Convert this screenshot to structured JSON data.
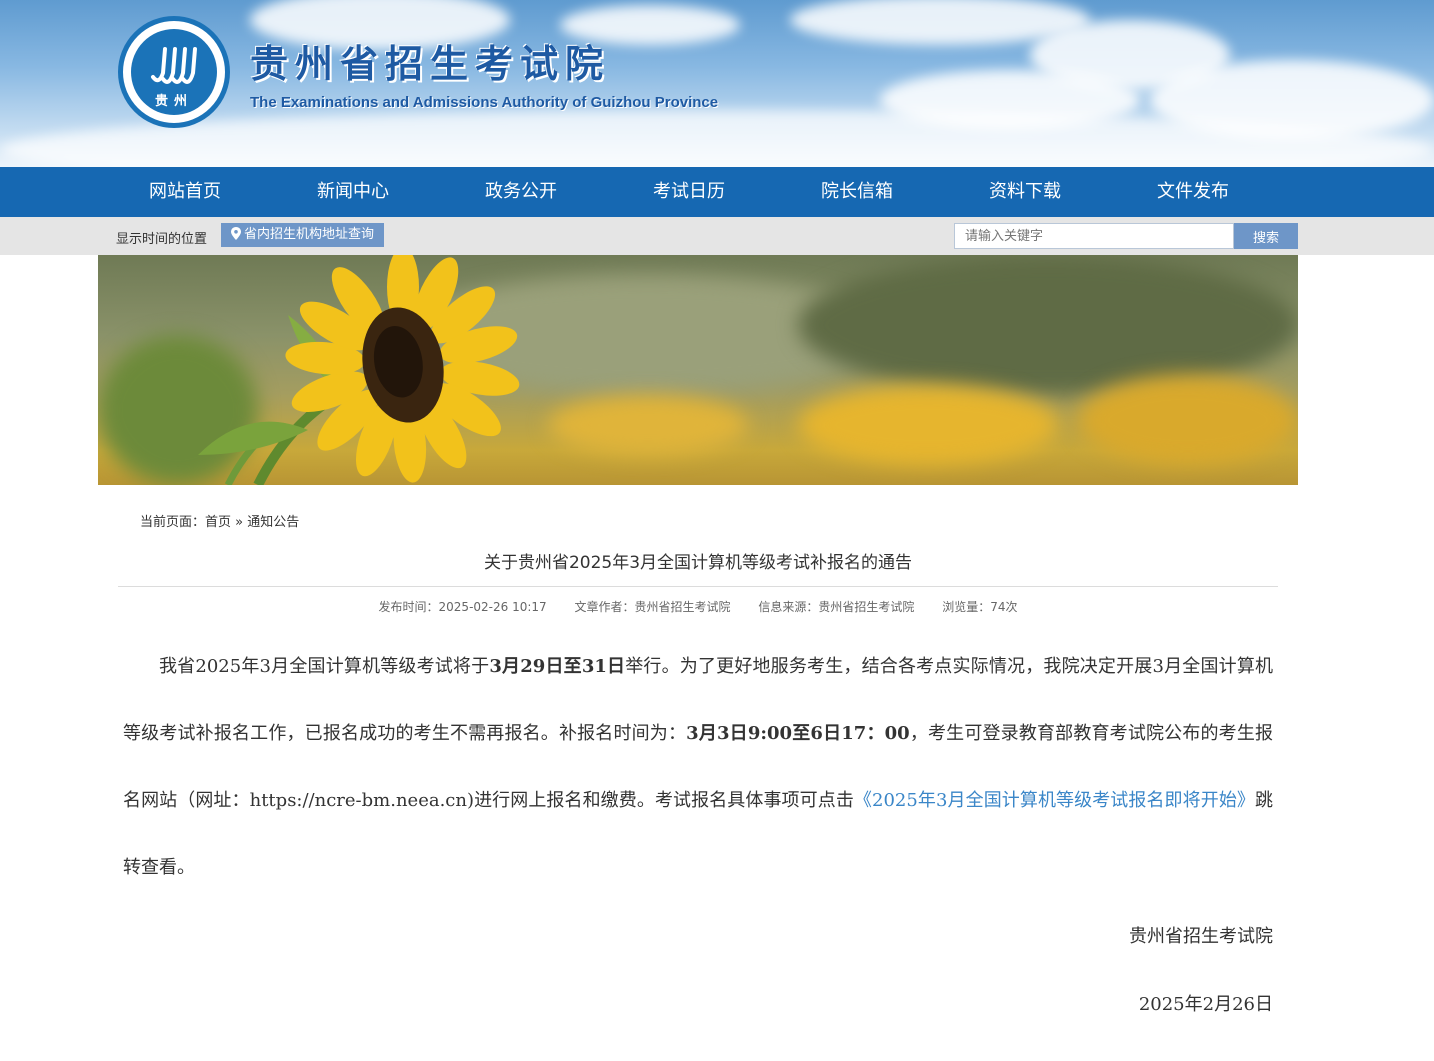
{
  "header": {
    "title": "贵州省招生考试院",
    "subtitle": "The Examinations and Admissions Authority of Guizhou Province",
    "emblem_text": "贵州"
  },
  "nav": {
    "items": [
      "网站首页",
      "新闻中心",
      "政务公开",
      "考试日历",
      "院长信箱",
      "资料下载",
      "文件发布"
    ]
  },
  "subbar": {
    "location_label": "显示时间的位置",
    "address_button": "省内招生机构地址查询",
    "search_placeholder": "请输入关键字",
    "search_button": "搜索"
  },
  "breadcrumb": {
    "prefix": "当前页面：",
    "home": "首页",
    "separator": " » ",
    "current": "通知公告"
  },
  "article": {
    "title": "关于贵州省2025年3月全国计算机等级考试补报名的通告",
    "meta": {
      "publish_time": "发布时间：2025-02-26 10:17",
      "author": "文章作者：贵州省招生考试院",
      "source": "信息来源：贵州省招生考试院",
      "views": "浏览量：74次"
    },
    "body": {
      "p1": "我省2025年3月全国计算机等级考试将于",
      "b1": "3月29日至31日",
      "p2": "举行。为了更好地服务考生，结合各考点实际情况，我院决定开展3月全国计算机等级考试补报名工作，已报名成功的考生不需再报名。补报名时间为：",
      "b2": "3月3日9:00至6日17：00",
      "p3": "，考生可登录教育部教育考试院公布的考生报名网站（网址：https://ncre-bm.neea.cn)进行网上报名和缴费。考试报名具体事项可点击",
      "link": "《2025年3月全国计算机等级考试报名即将开始》",
      "p4": "跳转查看。"
    },
    "signature": "贵州省招生考试院",
    "date": "2025年2月26日"
  },
  "colors": {
    "nav_bg": "#1668b2",
    "accent": "#6e96c8",
    "link": "#3a86c8"
  }
}
